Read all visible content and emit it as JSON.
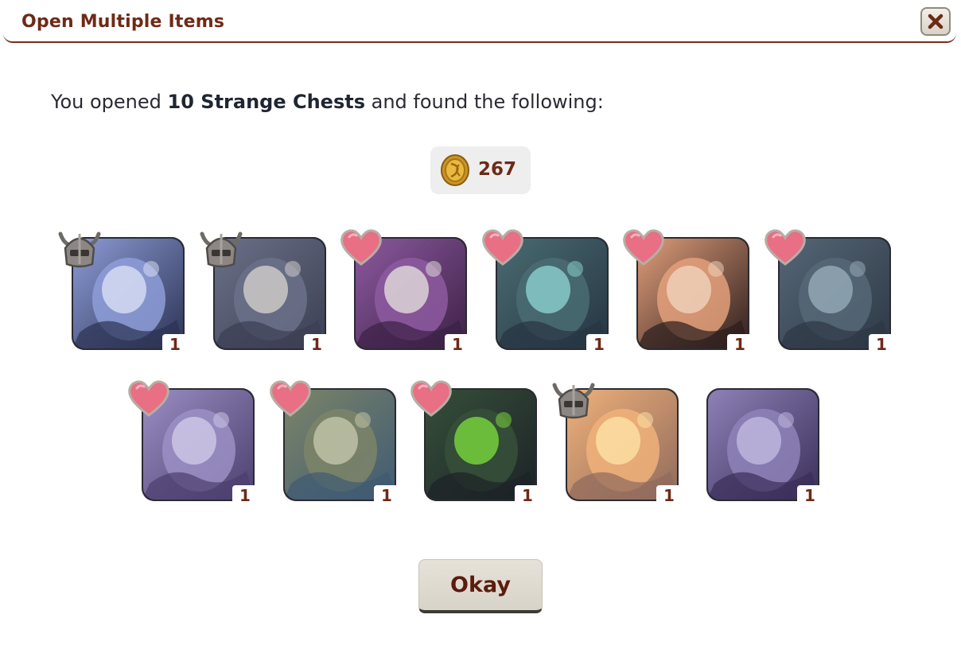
{
  "dialog": {
    "title": "Open Multiple Items",
    "close_icon": "close-x-icon"
  },
  "message": {
    "prefix": "You opened ",
    "bold": "10 Strange Chests",
    "suffix": " and found the following:"
  },
  "currency": {
    "icon": "gold-coin-icon",
    "amount": "267"
  },
  "items": [
    {
      "name": "item-blue-spirit-skin",
      "badge": "armor-helmet-icon",
      "qty": "1",
      "colors": [
        "#2b3251",
        "#8e9dd8",
        "#dfe4f7"
      ]
    },
    {
      "name": "item-dark-bone-claw",
      "badge": "armor-helmet-icon",
      "qty": "1",
      "colors": [
        "#3c3f52",
        "#6b7189",
        "#d9d6cf"
      ]
    },
    {
      "name": "item-ornate-clock",
      "badge": "heart-icon",
      "qty": "1",
      "colors": [
        "#3b2144",
        "#8d5aa0",
        "#e8e6e0"
      ]
    },
    {
      "name": "item-stone-gate",
      "badge": "heart-icon",
      "qty": "1",
      "colors": [
        "#263442",
        "#4a6c73",
        "#8fd7d5"
      ]
    },
    {
      "name": "item-copper-scroll",
      "badge": "heart-icon",
      "qty": "1",
      "colors": [
        "#2a1c1c",
        "#e3a07b",
        "#f2d7c0"
      ]
    },
    {
      "name": "item-slate-dragon-statue",
      "badge": "heart-icon",
      "qty": "1",
      "colors": [
        "#2d3845",
        "#566777",
        "#9bb0be"
      ]
    },
    {
      "name": "item-lilac-spiked-dragon",
      "badge": "heart-icon",
      "qty": "1",
      "colors": [
        "#4b3f6e",
        "#9b8fc4",
        "#d4cdea"
      ]
    },
    {
      "name": "item-spiked-barrel",
      "badge": "heart-icon",
      "qty": "1",
      "colors": [
        "#3f5a73",
        "#7d8568",
        "#c8cbb0"
      ]
    },
    {
      "name": "item-green-flame-forest",
      "badge": "heart-icon",
      "qty": "1",
      "colors": [
        "#1d2227",
        "#36503a",
        "#7fe13c"
      ]
    },
    {
      "name": "item-golden-cloud-moon",
      "badge": "armor-helmet-icon",
      "qty": "1",
      "colors": [
        "#8f6a5c",
        "#f0b27a",
        "#ffe6a8"
      ]
    },
    {
      "name": "item-violet-dragon-egg",
      "badge": "none",
      "qty": "1",
      "colors": [
        "#3a2e58",
        "#8e82b8",
        "#c5bde3"
      ]
    }
  ],
  "buttons": {
    "okay_label": "Okay"
  }
}
